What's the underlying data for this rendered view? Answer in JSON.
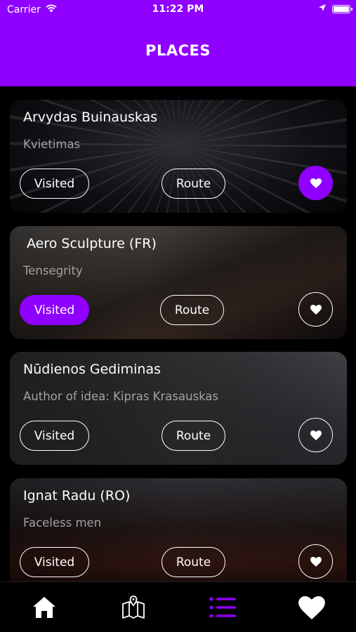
{
  "status_bar": {
    "carrier": "Carrier",
    "time": "11:22 PM",
    "icons": [
      "wifi-icon",
      "location-arrow-icon",
      "battery-icon"
    ]
  },
  "header": {
    "title": "PLACES",
    "background_color": "#8f00ff"
  },
  "places": [
    {
      "name": "Arvydas Buinauskas",
      "subtitle": "Kvietimas",
      "visited_label": "Visited",
      "route_label": "Route",
      "visited": false,
      "favorite": true
    },
    {
      "name": "Aero Sculpture (FR)",
      "subtitle": "Tensegrity",
      "visited_label": "Visited",
      "route_label": "Route",
      "visited": true,
      "favorite": false
    },
    {
      "name": "Nūdienos Gediminas",
      "subtitle": "Author of idea: Kipras Krasauskas",
      "visited_label": "Visited",
      "route_label": "Route",
      "visited": false,
      "favorite": false
    },
    {
      "name": "Ignat Radu (RO)",
      "subtitle": "Faceless men",
      "visited_label": "Visited",
      "route_label": "Route",
      "visited": false,
      "favorite": false
    }
  ],
  "tab_bar": {
    "items": [
      {
        "icon": "home-icon",
        "active": false
      },
      {
        "icon": "map-icon",
        "active": false
      },
      {
        "icon": "list-icon",
        "active": true
      },
      {
        "icon": "heart-icon",
        "active": false
      }
    ],
    "active_color": "#8f00ff",
    "inactive_color": "#ffffff"
  },
  "colors": {
    "accent": "#8f00ff",
    "subtitle_text": "#a3a3a3",
    "background": "#000000"
  }
}
